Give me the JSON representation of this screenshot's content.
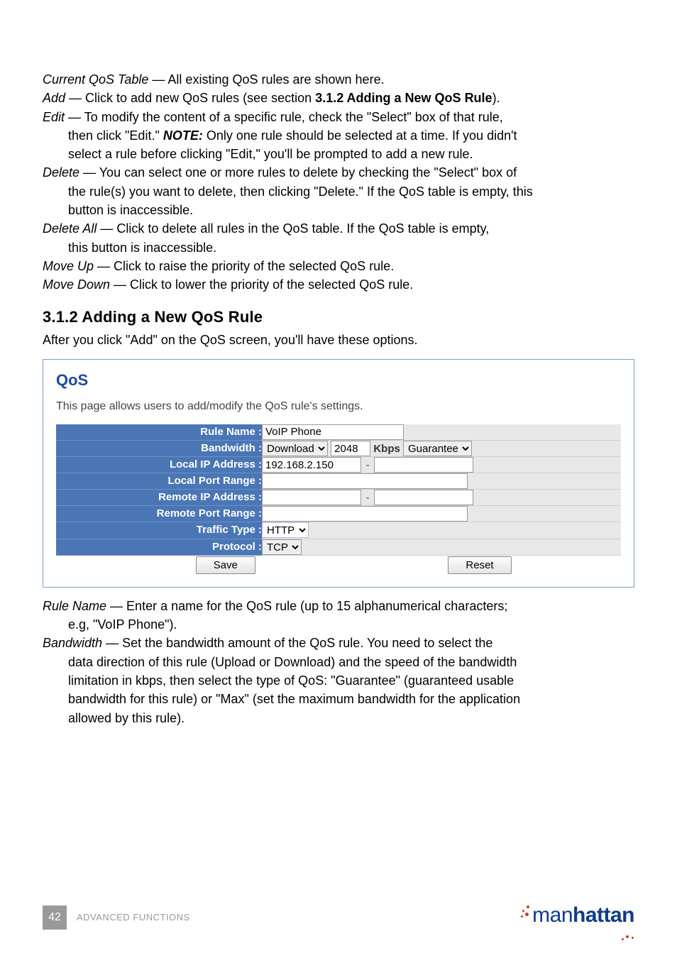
{
  "defs": {
    "current_qos_table": {
      "term": "Current QoS Table",
      "text": " — All existing QoS rules are shown here."
    },
    "add": {
      "term": "Add",
      "text1": " — Click to add new QoS rules (see section ",
      "ref": "3.1.2 Adding a New QoS Rule",
      "text2": ")."
    },
    "edit": {
      "term": "Edit",
      "line1": " — To modify the content of a specific rule, check the \"Select\" box of that rule,",
      "body1a": "then click \"Edit.\" ",
      "note_label": "NOTE:",
      "body1b": " Only one rule should be selected at a time. If you didn't",
      "body2": "select a rule before clicking \"Edit,\" you'll be prompted to add a new rule."
    },
    "delete": {
      "term": "Delete",
      "line1": " — You can select one or more rules to delete by checking the \"Select\" box of",
      "body1": "the rule(s) you want to delete, then clicking \"Delete.\" If the QoS table is empty, this",
      "body2": "button is inaccessible."
    },
    "delete_all": {
      "term": "Delete All",
      "line1": " — Click to delete all rules in the QoS table. If the QoS table is empty,",
      "body1": "this button is inaccessible."
    },
    "move_up": {
      "term": "Move Up",
      "text": " — Click to raise the priority of the selected QoS rule."
    },
    "move_down": {
      "term": "Move Down",
      "text": " — Click to lower the priority of the selected QoS rule."
    }
  },
  "heading": "3.1.2  Adding a New QoS Rule",
  "after_heading": "After you click \"Add\" on the QoS screen, you'll have these options.",
  "panel": {
    "title": "QoS",
    "subtitle": "This page allows users to add/modify the QoS rule's settings.",
    "labels": {
      "rule_name": "Rule Name :",
      "bandwidth": "Bandwidth :",
      "local_ip": "Local IP Address :",
      "local_port": "Local Port Range :",
      "remote_ip": "Remote IP Address :",
      "remote_port": "Remote Port Range :",
      "traffic_type": "Traffic Type :",
      "protocol": "Protocol :"
    },
    "values": {
      "rule_name": "VoIP Phone",
      "bw_dir": "Download",
      "bw_amount": "2048",
      "bw_unit": "Kbps",
      "bw_type": "Guarantee",
      "local_ip": "192.168.2.150",
      "traffic_type": "HTTP",
      "protocol": "TCP"
    },
    "buttons": {
      "save": "Save",
      "reset": "Reset"
    }
  },
  "post": {
    "rule_name": {
      "term": "Rule Name",
      "line1": " — Enter a name for the QoS rule (up to 15 alphanumerical characters;",
      "body1": "e.g, \"VoIP Phone\")."
    },
    "bandwidth": {
      "term": "Bandwidth",
      "line1": " — Set the bandwidth amount of the QoS rule. You need to select the",
      "body1": "data direction of this rule (Upload or Download) and the speed of the bandwidth",
      "body2": "limitation in kbps, then select the type of QoS: \"Guarantee\" (guaranteed usable",
      "body3": "bandwidth for this rule) or \"Max\" (set the maximum bandwidth for the application",
      "body4": "allowed by this rule)."
    }
  },
  "footer": {
    "page": "42",
    "label": "ADVANCED FUNCTIONS",
    "brand_light": "man",
    "brand_bold": "hattan"
  }
}
